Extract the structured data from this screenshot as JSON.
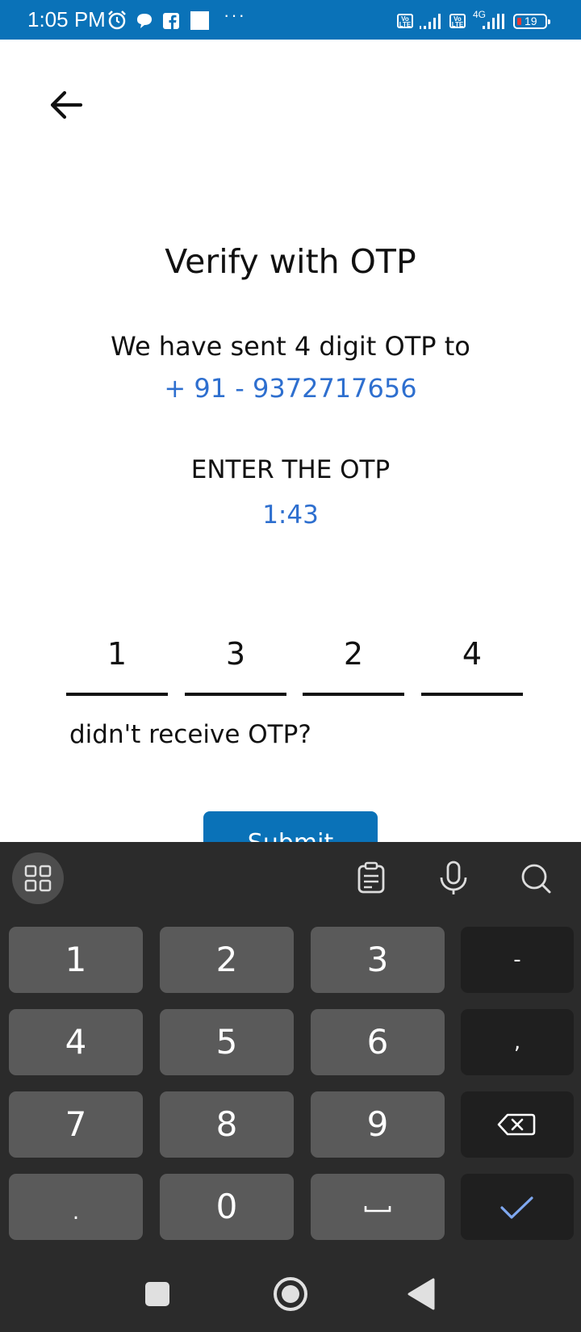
{
  "status_bar": {
    "time": "1:05 PM",
    "icons": [
      "alarm-icon",
      "chat-icon",
      "facebook-icon",
      "square-icon",
      "more-icon"
    ],
    "volte_label": "Vo LTE",
    "network": "4G",
    "battery_level": "19",
    "battery_color": "#e53935"
  },
  "header": {
    "back_label": ""
  },
  "main": {
    "title": "Verify with OTP",
    "sent_text": "We have sent 4 digit OTP to",
    "phone": "+ 91 - 9372717656",
    "enter_label": "ENTER THE OTP",
    "timer": "1:43",
    "otp_digits": [
      "1",
      "3",
      "2",
      "4"
    ],
    "resend_text": "didn't receive OTP?",
    "submit_label": "Submit"
  },
  "keyboard": {
    "toolbar": [
      "grid-icon",
      "clipboard-icon",
      "microphone-icon",
      "search-icon"
    ],
    "keys": [
      [
        "1",
        "2",
        "3",
        "-"
      ],
      [
        "4",
        "5",
        "6",
        ","
      ],
      [
        "7",
        "8",
        "9",
        "backspace"
      ],
      [
        ".",
        "0",
        "space",
        "enter"
      ]
    ]
  },
  "nav": [
    "recents-button",
    "home-button",
    "back-button"
  ],
  "colors": {
    "brand": "#0A72B8",
    "link": "#2E6FCF",
    "keyboard_bg": "#2B2B2B",
    "key_bg": "#5A5A5A",
    "key_dark": "#1F1F1F"
  }
}
